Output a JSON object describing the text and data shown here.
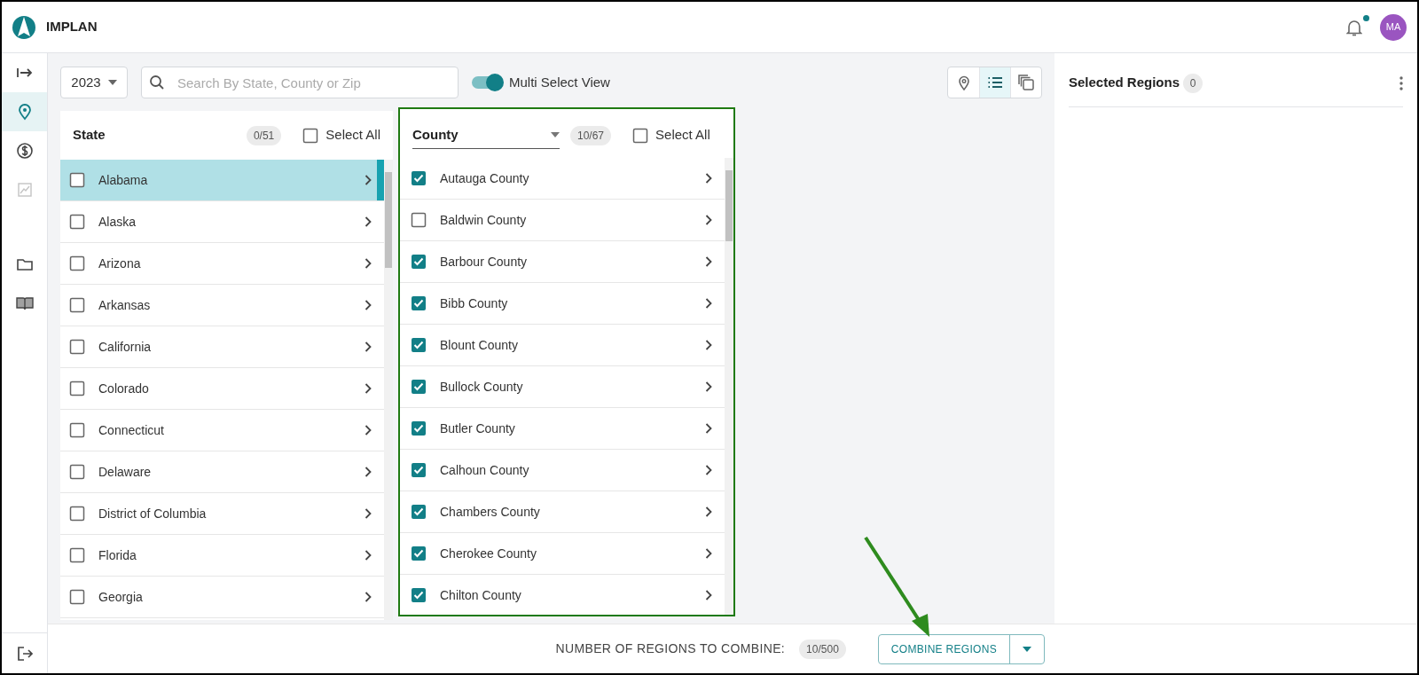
{
  "app": {
    "name": "IMPLAN",
    "notification_dot": true,
    "avatar": "MA"
  },
  "sidebar": {
    "items": [
      {
        "selected": false,
        "disabled": false
      },
      {
        "selected": true,
        "disabled": false
      },
      {
        "selected": false,
        "disabled": false
      },
      {
        "selected": false,
        "disabled": true
      },
      {
        "selected": false,
        "disabled": false
      },
      {
        "selected": false,
        "disabled": false
      }
    ]
  },
  "toolbar": {
    "year": "2023",
    "search": {
      "placeholder": "Search By State, County or Zip"
    },
    "multi_select": {
      "label": "Multi Select View",
      "on": true
    },
    "views": [
      {
        "selected": false
      },
      {
        "selected": true
      },
      {
        "selected": false
      }
    ]
  },
  "state_panel": {
    "title": "State",
    "count": "0/51",
    "select_all": {
      "label": "Select All",
      "checked": false
    },
    "rows": [
      {
        "name": "Alabama",
        "checked": false,
        "selected": true
      },
      {
        "name": "Alaska",
        "checked": false,
        "selected": false
      },
      {
        "name": "Arizona",
        "checked": false,
        "selected": false
      },
      {
        "name": "Arkansas",
        "checked": false,
        "selected": false
      },
      {
        "name": "California",
        "checked": false,
        "selected": false
      },
      {
        "name": "Colorado",
        "checked": false,
        "selected": false
      },
      {
        "name": "Connecticut",
        "checked": false,
        "selected": false
      },
      {
        "name": "Delaware",
        "checked": false,
        "selected": false
      },
      {
        "name": "District of Columbia",
        "checked": false,
        "selected": false
      },
      {
        "name": "Florida",
        "checked": false,
        "selected": false
      },
      {
        "name": "Georgia",
        "checked": false,
        "selected": false
      }
    ]
  },
  "county_panel": {
    "level_dropdown": "County",
    "count": "10/67",
    "select_all": {
      "label": "Select All",
      "checked": false
    },
    "rows": [
      {
        "name": "Autauga County",
        "checked": true
      },
      {
        "name": "Baldwin County",
        "checked": false
      },
      {
        "name": "Barbour County",
        "checked": true
      },
      {
        "name": "Bibb County",
        "checked": true
      },
      {
        "name": "Blount County",
        "checked": true
      },
      {
        "name": "Bullock County",
        "checked": true
      },
      {
        "name": "Butler County",
        "checked": true
      },
      {
        "name": "Calhoun County",
        "checked": true
      },
      {
        "name": "Chambers County",
        "checked": true
      },
      {
        "name": "Cherokee County",
        "checked": true
      },
      {
        "name": "Chilton County",
        "checked": true
      }
    ]
  },
  "footer": {
    "label": "NUMBER OF REGIONS TO COMBINE:",
    "count": "10/500",
    "button": "COMBINE REGIONS"
  },
  "selected_regions": {
    "title": "Selected Regions",
    "count": "0"
  }
}
